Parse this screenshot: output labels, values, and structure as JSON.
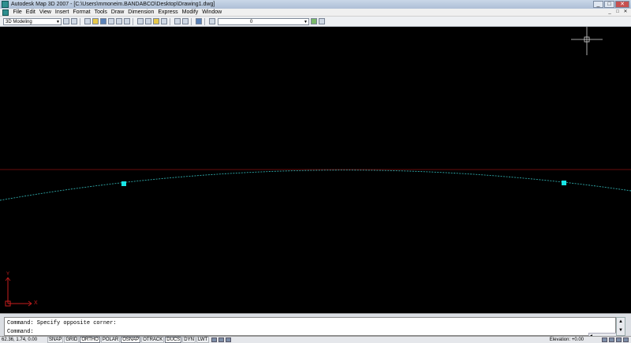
{
  "window": {
    "title": "Autodesk Map 3D 2007 - [C:\\Users\\mmoneim.BANDABCO\\Desktop\\Drawing1.dwg]",
    "minimize": "_",
    "maximize": "□",
    "close": "✕"
  },
  "menu": {
    "items": [
      "File",
      "Edit",
      "View",
      "Insert",
      "Format",
      "Tools",
      "Draw",
      "Dimension",
      "Express",
      "Modify",
      "Window"
    ],
    "doc_minimize": "_",
    "doc_restore": "□",
    "doc_close": "✕"
  },
  "toolbar": {
    "workspace": "3D Modeling",
    "layer": "0",
    "dropdown_arrow": "▼"
  },
  "command": {
    "line1": "Command: Specify opposite corner:",
    "line2": "Command:",
    "scroll_up": "▲",
    "scroll_down": "▼"
  },
  "status": {
    "coordinates": "62.36, 1.74, 0.00",
    "toggles": [
      {
        "label": "SNAP",
        "on": false
      },
      {
        "label": "GRID",
        "on": false
      },
      {
        "label": "ORTHO",
        "on": true
      },
      {
        "label": "POLAR",
        "on": false
      },
      {
        "label": "OSNAP",
        "on": true
      },
      {
        "label": "OTRACK",
        "on": false
      },
      {
        "label": "DUCS",
        "on": true
      },
      {
        "label": "DYN",
        "on": false
      },
      {
        "label": "LWT",
        "on": false
      }
    ],
    "elevation": "Elevation: +0.00"
  },
  "ucs": {
    "x_label": "X",
    "y_label": "Y"
  },
  "colors": {
    "canvas": "#000000",
    "curve": "#2fa7a7",
    "grip": "#19e6e6",
    "horizon_line": "#8a1010",
    "ucs": "#c81e1e",
    "crosshair": "#d8d8d8"
  }
}
